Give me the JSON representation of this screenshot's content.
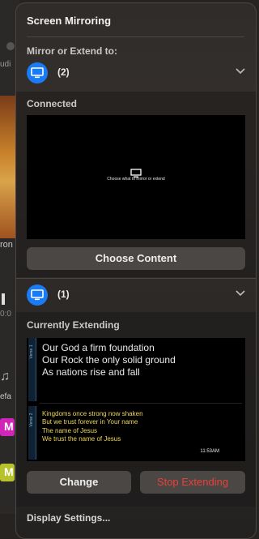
{
  "background_app": {
    "audio_fragment": "udi",
    "label_fragment": "ron",
    "time_fragment": "0:0",
    "music_fragment": "efa",
    "tile_letter_1": "M",
    "tile_letter_2": "M"
  },
  "panel": {
    "title": "Screen Mirroring",
    "mirror_label": "Mirror or Extend to:",
    "display_group_1": {
      "count": "(2)",
      "status_label": "Connected",
      "preview_message": "Choose what to mirror or extend",
      "choose_button": "Choose Content"
    },
    "display_group_2": {
      "count": "(1)",
      "status_label": "Currently Extending",
      "preview": {
        "tab_label_1": "Verse 1",
        "tab_label_2": "Verse 2",
        "lines_large": [
          "Our God a firm foundation",
          "Our Rock the only solid ground",
          "As nations rise and fall"
        ],
        "lines_small": [
          "Kingdoms once strong now shaken",
          "But we trust forever in Your name",
          "The name of Jesus",
          "We trust the name of Jesus"
        ],
        "clock": "11:53AM"
      },
      "change_button": "Change",
      "stop_button": "Stop Extending"
    },
    "display_settings_label": "Display Settings..."
  },
  "colors": {
    "accent_blue": "#1a7cf5",
    "stop_red": "#e8413a"
  },
  "icons": {
    "display": "display-icon",
    "chevron": "chevron-down-icon",
    "monitor": "monitor-icon"
  }
}
